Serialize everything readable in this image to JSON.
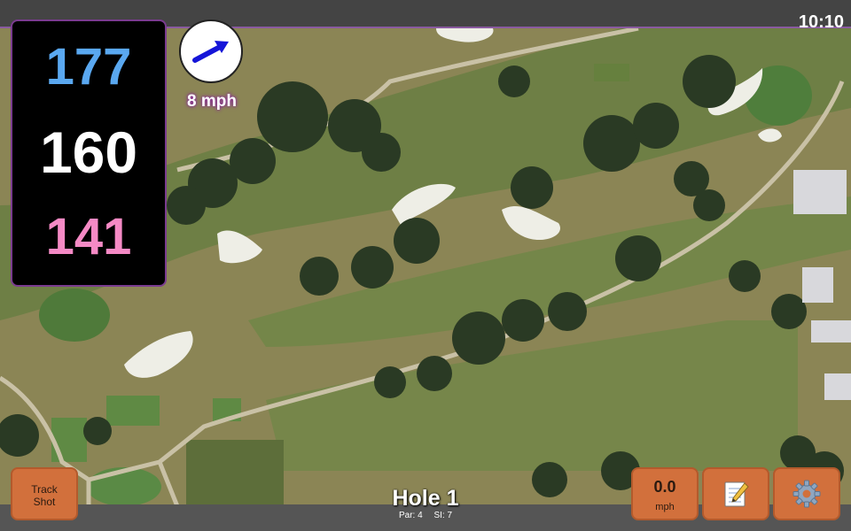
{
  "status_bar": {
    "clock": "10:10"
  },
  "yardage": {
    "back": "177",
    "center": "160",
    "front": "141"
  },
  "wind": {
    "speed_label": "8 mph",
    "arrow_icon": "wind-direction-arrow-icon",
    "color": "#1515d8"
  },
  "buttons": {
    "track_shot": {
      "label_line1": "Track",
      "label_line2": "Shot"
    },
    "speed": {
      "value": "0.0",
      "unit": "mph"
    },
    "notes_icon": "notepad-icon",
    "settings_icon": "gear-icon"
  },
  "hole": {
    "title": "Hole 1",
    "par_label": "Par: 4",
    "si_label": "SI: 7"
  },
  "colors": {
    "back_yardage": "#5aa8f0",
    "center_yardage": "#ffffff",
    "front_yardage": "#f58ac5",
    "button": "#d2703c",
    "panel_border": "#7a3b8f"
  }
}
